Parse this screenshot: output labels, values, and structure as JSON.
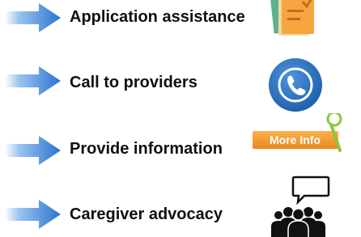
{
  "items": [
    {
      "label": "Application assistance",
      "icon": "documents-icon"
    },
    {
      "label": "Call to providers",
      "icon": "phone-icon"
    },
    {
      "label": "Provide information",
      "icon": "more-info-icon"
    },
    {
      "label": "Caregiver advocacy",
      "icon": "advocacy-people-icon"
    }
  ],
  "more_info": {
    "text": "More Info"
  },
  "colors": {
    "arrow": "#3f86d6",
    "phone": "#2d6fb8",
    "more_info_bg": "#f39b2a",
    "magnifier": "#8cc63f",
    "docs_orange": "#f7a541",
    "docs_green": "#61b08c",
    "docs_tan": "#f3d7a2"
  }
}
